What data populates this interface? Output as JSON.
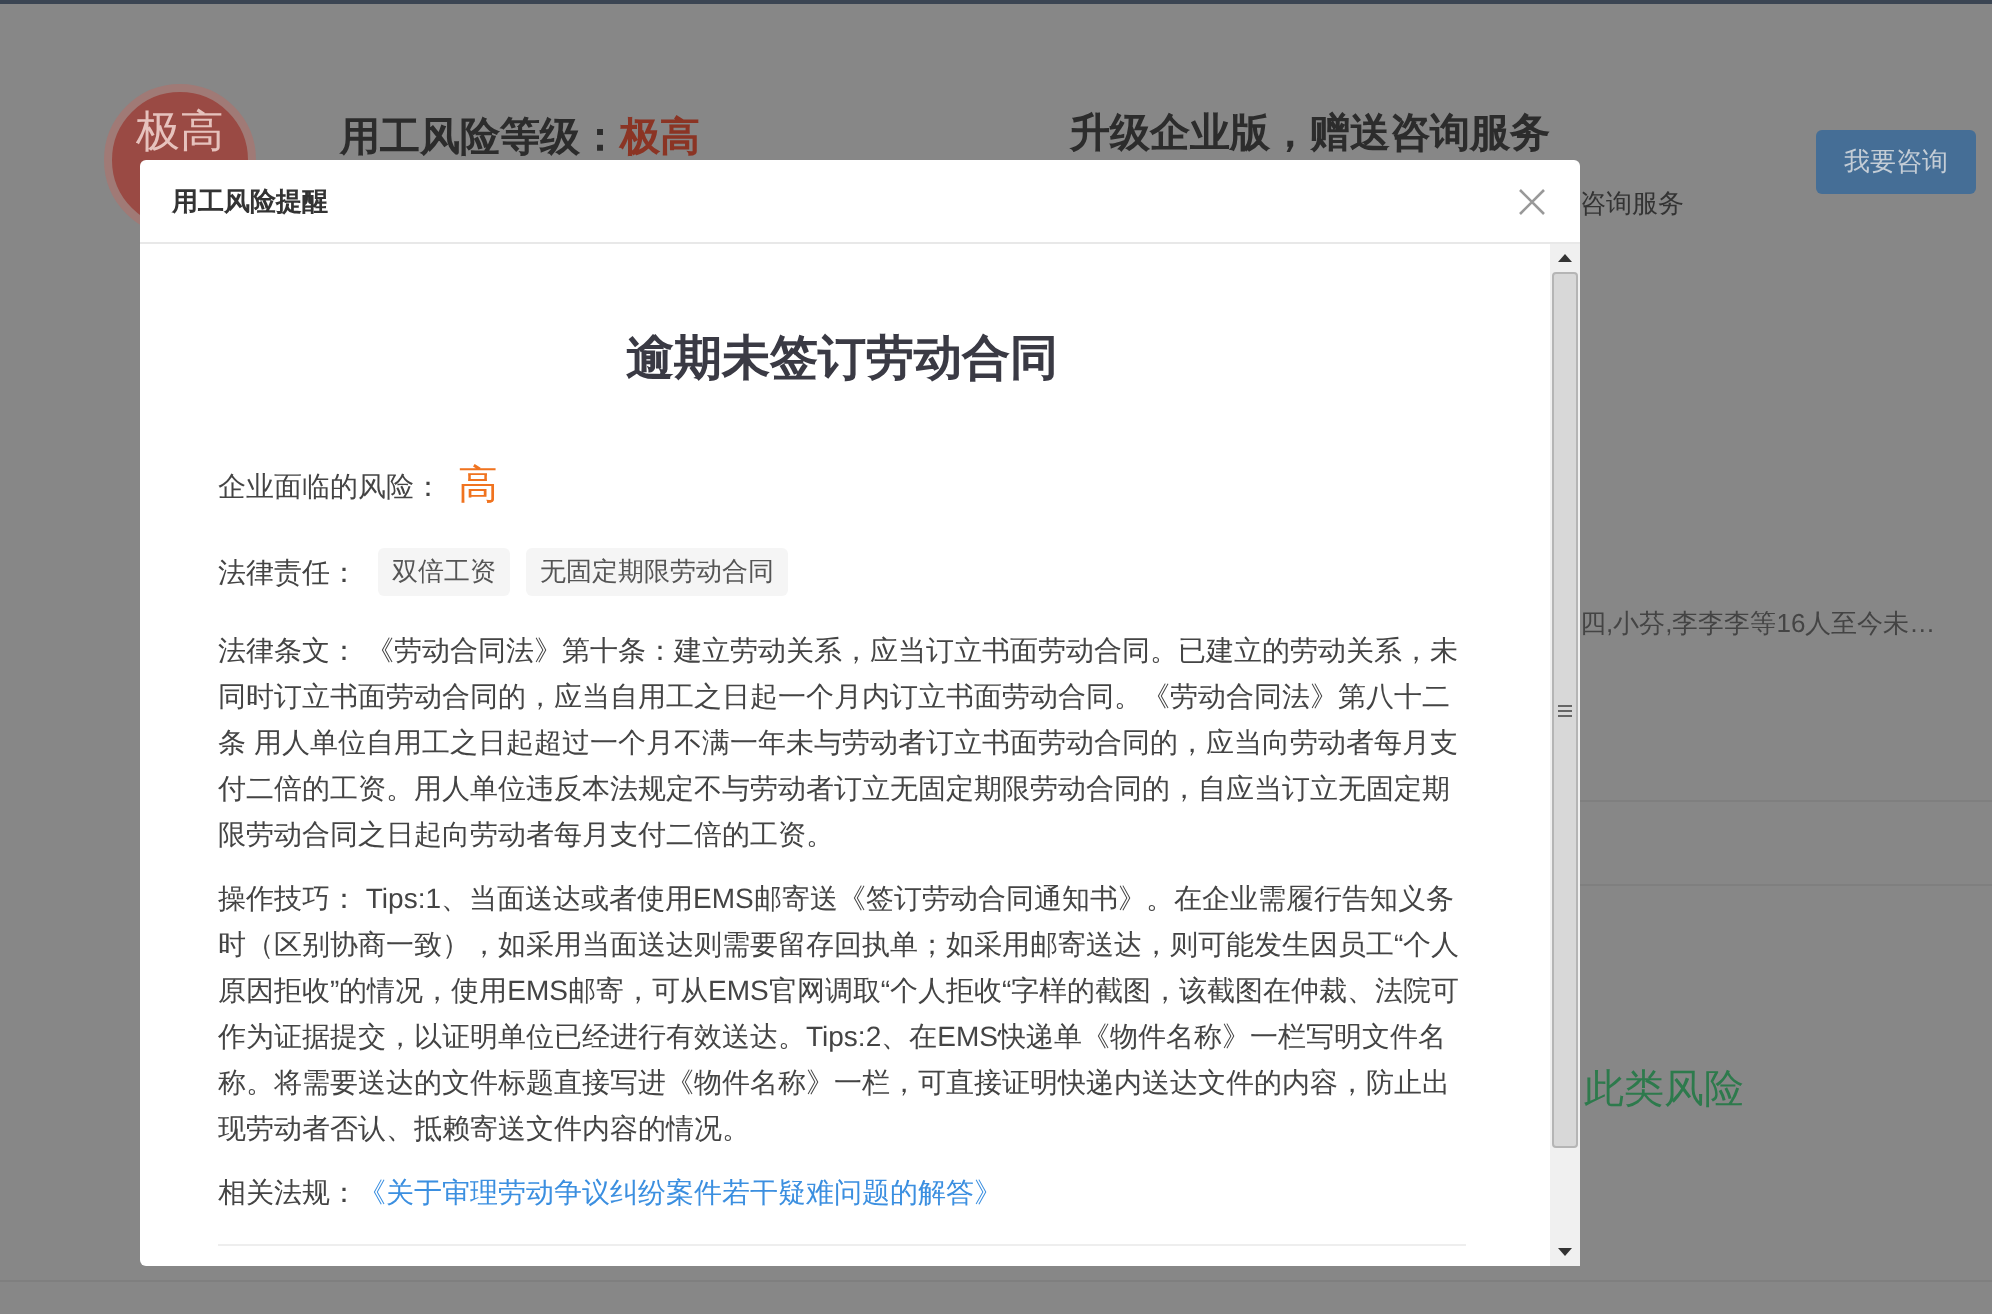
{
  "background": {
    "risk_badge": "极高",
    "risk_title": {
      "label": "用工风险等级：",
      "level": "极高"
    },
    "promo_title": "升级企业版，赠送咨询服务",
    "promo_text": "咨询服务",
    "consult_button": "我要咨询",
    "employee_note": "四,小芬,李李李等16人至今未…",
    "status_text": "此类风险"
  },
  "dialog": {
    "title": "用工风险提醒",
    "heading": "逾期未签订劳动合同",
    "risk": {
      "label": "企业面临的风险：",
      "value": "高"
    },
    "liability": {
      "label": "法律责任：",
      "tags": [
        "双倍工资",
        "无固定期限劳动合同"
      ]
    },
    "paragraphs": [
      "法律条文： 《劳动合同法》第十条：建立劳动关系，应当订立书面劳动合同。已建立的劳动关系，未同时订立书面劳动合同的，应当自用工之日起一个月内订立书面劳动合同。《劳动合同法》第八十二条 用人单位自用工之日起超过一个月不满一年未与劳动者订立书面劳动合同的，应当向劳动者每月支付二倍的工资。用人单位违反本法规定不与劳动者订立无固定期限劳动合同的，自应当订立无固定期限劳动合同之日起向劳动者每月支付二倍的工资。",
      "操作技巧： Tips:1、当面送达或者使用EMS邮寄送《签订劳动合同通知书》。在企业需履行告知义务时（区别协商一致），如采用当面送达则需要留存回执单；如采用邮寄送达，则可能发生因员工“个人原因拒收”的情况，使用EMS邮寄，可从EMS官网调取“个人拒收“字样的截图，该截图在仲裁、法院可作为证据提交，以证明单位已经进行有效送达。Tips:2、在EMS快递单《物件名称》一栏写明文件名称。将需要送达的文件标题直接写进《物件名称》一栏，可直接证明快递内送达文件的内容，防止出现劳动者否认、抵赖寄送文件内容的情况。"
    ],
    "related": {
      "label": "相关法规：",
      "link": "《关于审理劳动争议纠纷案件若干疑难问题的解答》"
    }
  }
}
